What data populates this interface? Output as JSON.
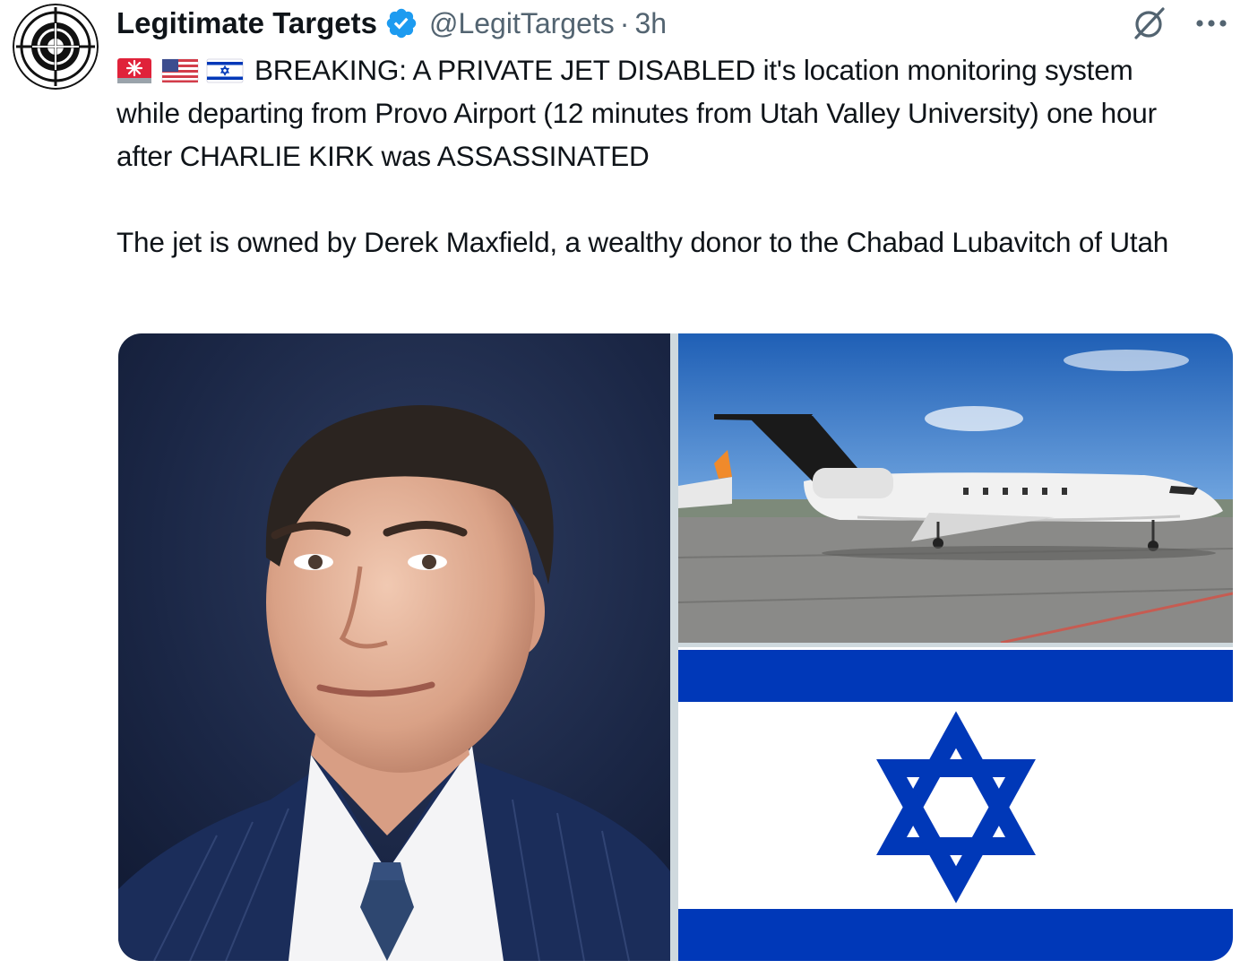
{
  "account": {
    "display_name": "Legitimate Targets",
    "handle": "@LegitTargets",
    "separator": "·",
    "time": "3h",
    "verified": true,
    "verified_color": "#1d9bf0"
  },
  "icons": {
    "avatar": "crosshair-target-logo",
    "verified": "verified-badge-icon",
    "grok": "grok-icon",
    "more": "more-dots-icon",
    "emojis": [
      "siren-flag-emoji",
      "us-flag-emoji",
      "israel-flag-emoji"
    ]
  },
  "tweet": {
    "paragraph_1": "BREAKING: A PRIVATE JET DISABLED it's location monitoring system while departing from Provo Airport (12 minutes from Utah Valley University) one hour after CHARLIE KIRK was ASSASSINATED",
    "paragraph_2": "The jet is owned by Derek Maxfield, a wealthy donor to the Chabad Lubavitch of Utah"
  },
  "media": {
    "images": [
      {
        "content": "portrait of man in navy pinstripe suit"
      },
      {
        "content": "white private jet on tarmac"
      },
      {
        "content": "flag of Israel"
      }
    ]
  },
  "colors": {
    "text": "#0f1419",
    "secondary_text": "#536471",
    "flag_blue": "#0038b8"
  }
}
